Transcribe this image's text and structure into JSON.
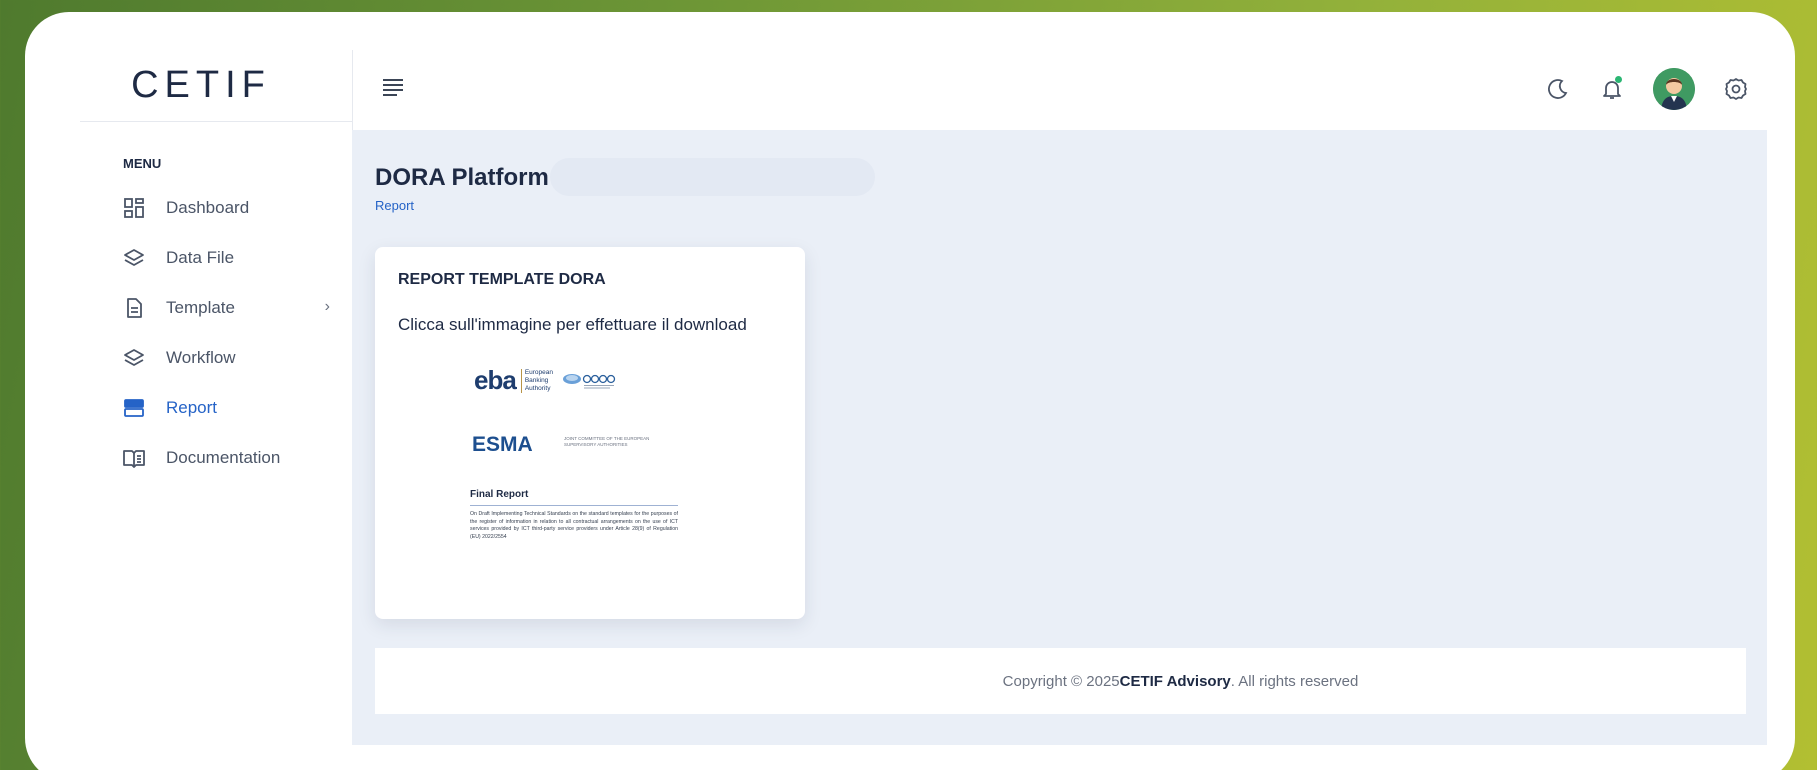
{
  "brand": {
    "logo_text": "CETIF"
  },
  "sidebar": {
    "menu_title": "MENU",
    "items": [
      {
        "label": "Dashboard",
        "icon": "dashboard-icon"
      },
      {
        "label": "Data File",
        "icon": "layers-icon"
      },
      {
        "label": "Template",
        "icon": "document-icon",
        "has_submenu": true
      },
      {
        "label": "Workflow",
        "icon": "layers-icon"
      },
      {
        "label": "Report",
        "icon": "server-icon",
        "active": true
      },
      {
        "label": "Documentation",
        "icon": "book-icon"
      }
    ]
  },
  "topbar": {
    "icons": [
      "menu-icon",
      "moon-icon",
      "bell-icon",
      "avatar",
      "gear-icon"
    ]
  },
  "page": {
    "title": "DORA Platform",
    "breadcrumb": "Report"
  },
  "card": {
    "title": "REPORT TEMPLATE DORA",
    "subtitle": "Clicca sull'immagine per effettuare il download",
    "thumbnail": {
      "eba_word": "eba",
      "eba_line1": "European",
      "eba_line2": "Banking",
      "eba_line3": "Authority",
      "esma_word": "ESMA",
      "esma_note": "JOINT COMMITTEE OF THE EUROPEAN SUPERVISORY AUTHORITIES",
      "report_title": "Final Report",
      "report_body": "On Draft Implementing Technical Standards on the standard templates for the purposes of the register of information in relation to all contractual arrangements on the use of ICT services provided by ICT third-party service providers under Article 28(9) of Regulation (EU) 2022/2554"
    }
  },
  "footer": {
    "prefix": "Copyright © 2025 ",
    "company": "CETIF Advisory",
    "suffix": ". All rights reserved"
  },
  "colors": {
    "accent": "#2563c7",
    "text_dark": "#1e2a44",
    "main_bg": "#eaeff7"
  }
}
